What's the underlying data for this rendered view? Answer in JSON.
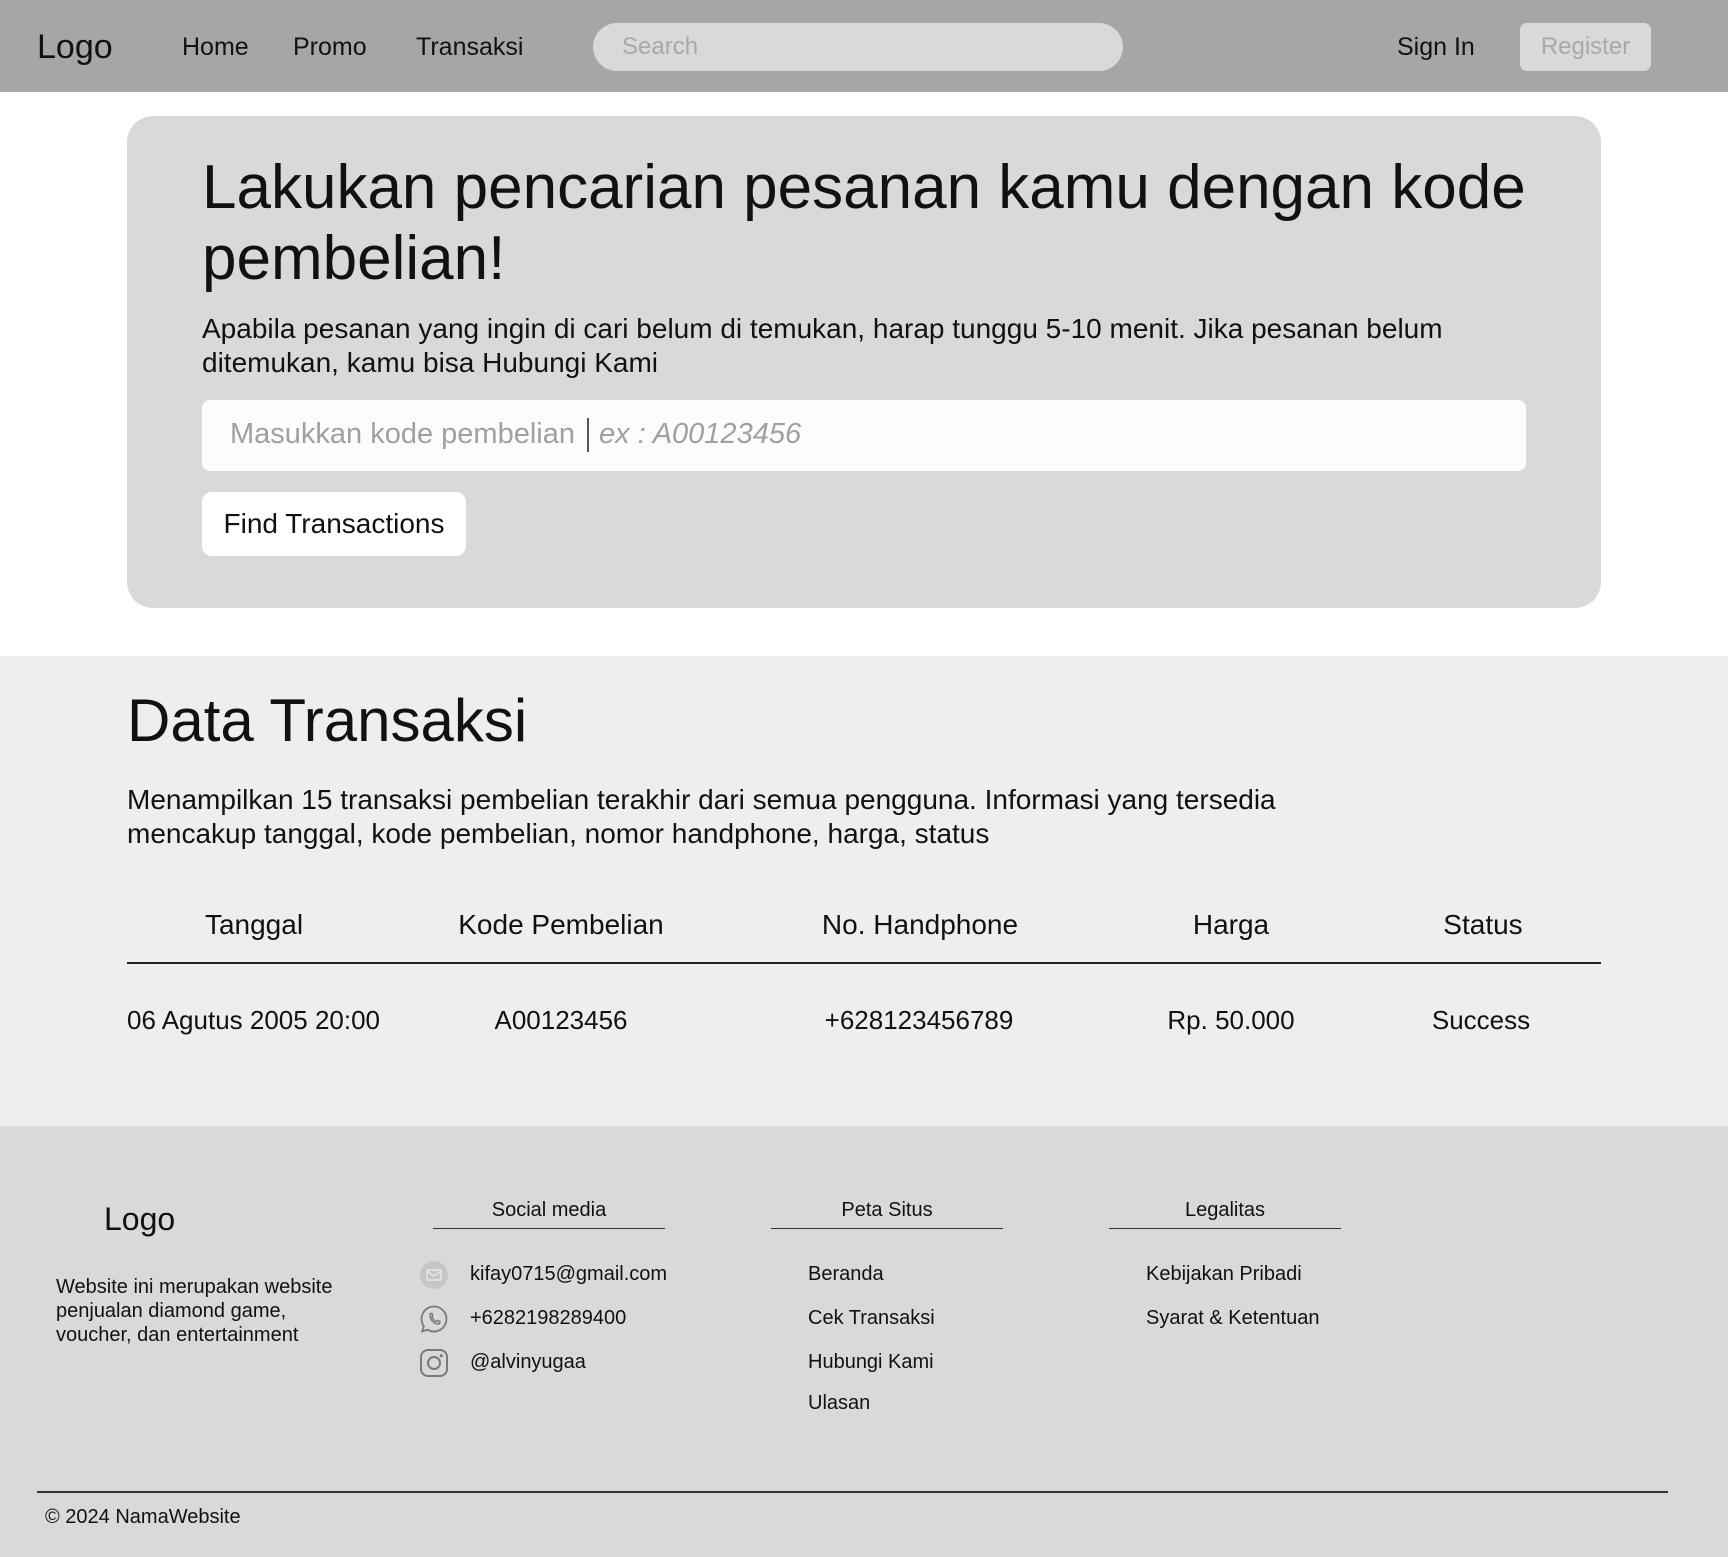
{
  "nav": {
    "logo": "Logo",
    "links": [
      "Home",
      "Promo",
      "Transaksi"
    ],
    "search_placeholder": "Search",
    "sign_in": "Sign In",
    "register": "Register"
  },
  "hero": {
    "title": "Lakukan pencarian pesanan kamu dengan kode pembelian!",
    "description": "Apabila pesanan yang ingin di cari belum di temukan, harap tunggu 5-10 menit. Jika pesanan belum ditemukan, kamu bisa Hubungi Kami",
    "input_placeholder": "Masukkan kode pembelian",
    "input_example": "ex : A00123456",
    "button": "Find Transactions"
  },
  "transactions": {
    "title": "Data Transaksi",
    "description": "Menampilkan 15 transaksi pembelian terakhir dari semua pengguna. Informasi yang tersedia mencakup tanggal, kode pembelian, nomor handphone, harga, status",
    "headers": [
      "Tanggal",
      "Kode Pembelian",
      "No. Handphone",
      "Harga",
      "Status"
    ],
    "rows": [
      [
        "06 Agutus 2005 20:00",
        "A00123456",
        "+628123456789",
        "Rp. 50.000",
        "Success"
      ]
    ]
  },
  "footer": {
    "logo": "Logo",
    "about": "Website ini merupakan website penjualan diamond game, voucher, dan entertainment",
    "social": {
      "heading": "Social media",
      "items": [
        {
          "icon": "mail-icon",
          "label": "kifay0715@gmail.com"
        },
        {
          "icon": "whatsapp-icon",
          "label": "+6282198289400"
        },
        {
          "icon": "instagram-icon",
          "label": "@alvinyugaa"
        }
      ]
    },
    "sitemap": {
      "heading": "Peta Situs",
      "links": [
        "Beranda",
        "Cek Transaksi",
        "Hubungi Kami",
        "Ulasan"
      ]
    },
    "legal": {
      "heading": "Legalitas",
      "links": [
        "Kebijakan Pribadi",
        "Syarat & Ketentuan"
      ]
    },
    "copyright": "© 2024 NamaWebsite"
  }
}
